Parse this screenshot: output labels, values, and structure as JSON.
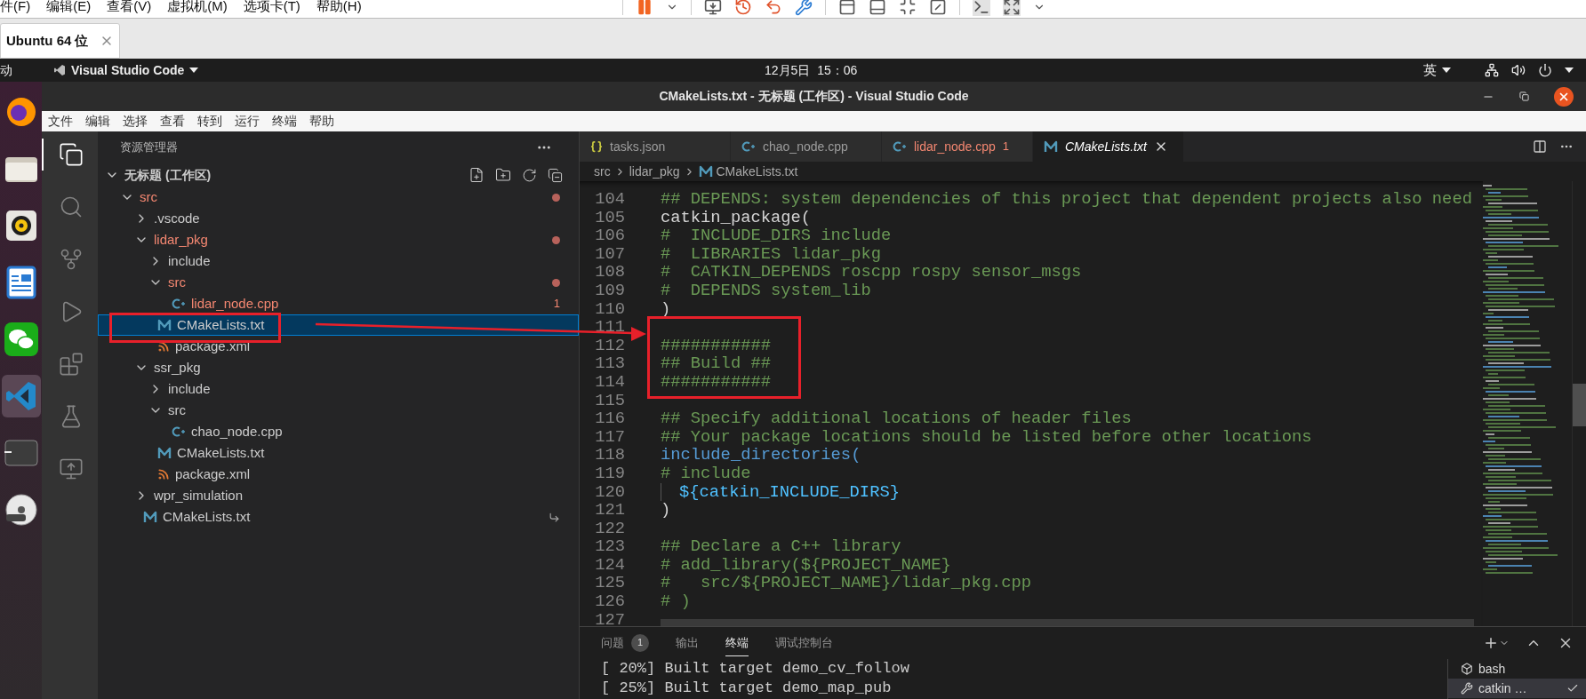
{
  "vm": {
    "menu": [
      "件(F)",
      "编辑(E)",
      "查看(V)",
      "虚拟机(M)",
      "选项卡(T)",
      "帮助(H)"
    ],
    "tabs": [
      {
        "label": "Ubuntu 64 位",
        "selected": true
      }
    ]
  },
  "ubuntu_bar": {
    "activities": "动",
    "app": "Visual Studio Code",
    "clock": "12月5日  15：06",
    "input_method": "英"
  },
  "dock": [
    {
      "kind": "firefox",
      "selected": false
    },
    {
      "kind": "files",
      "selected": false
    },
    {
      "kind": "speaker",
      "selected": false
    },
    {
      "kind": "writer",
      "selected": false
    },
    {
      "kind": "chat",
      "selected": false
    },
    {
      "kind": "vscode",
      "selected": true
    },
    {
      "kind": "terminal",
      "selected": false
    },
    {
      "kind": "disc",
      "selected": false
    }
  ],
  "window": {
    "title": "CMakeLists.txt - 无标题 (工作区) - Visual Studio Code"
  },
  "menu": [
    "文件",
    "编辑",
    "选择",
    "查看",
    "转到",
    "运行",
    "终端",
    "帮助"
  ],
  "activity_bar": [
    {
      "kind": "explorer",
      "selected": true
    },
    {
      "kind": "search",
      "selected": false
    },
    {
      "kind": "scm",
      "selected": false
    },
    {
      "kind": "debug",
      "selected": false
    },
    {
      "kind": "extensions",
      "selected": false
    },
    {
      "kind": "testing",
      "selected": false
    },
    {
      "kind": "remote",
      "selected": false
    }
  ],
  "sidebar": {
    "title": "资源管理器",
    "workspace": {
      "label": "无标题 (工作区)",
      "expanded": true,
      "children": [
        {
          "label": "src",
          "kind": "folder",
          "expanded": true,
          "error": true,
          "selected": false,
          "children": [
            {
              "label": ".vscode",
              "kind": "folder",
              "expanded": false,
              "error": false,
              "selected": false
            },
            {
              "label": "lidar_pkg",
              "kind": "folder",
              "expanded": true,
              "error": true,
              "selected": false,
              "children": [
                {
                  "label": "include",
                  "kind": "folder",
                  "expanded": false,
                  "error": false,
                  "selected": false
                },
                {
                  "label": "src",
                  "kind": "folder",
                  "expanded": true,
                  "error": true,
                  "selected": false,
                  "children": [
                    {
                      "label": "lidar_node.cpp",
                      "kind": "cpp",
                      "error": true,
                      "badge": "1",
                      "selected": false
                    }
                  ]
                },
                {
                  "label": "CMakeLists.txt",
                  "kind": "cmake",
                  "error": false,
                  "selected": true
                },
                {
                  "label": "package.xml",
                  "kind": "xml",
                  "error": false,
                  "selected": false
                }
              ]
            },
            {
              "label": "ssr_pkg",
              "kind": "folder",
              "expanded": true,
              "error": false,
              "selected": false,
              "children": [
                {
                  "label": "include",
                  "kind": "folder",
                  "expanded": false,
                  "error": false,
                  "selected": false
                },
                {
                  "label": "src",
                  "kind": "folder",
                  "expanded": true,
                  "error": false,
                  "selected": false,
                  "children": [
                    {
                      "label": "chao_node.cpp",
                      "kind": "cpp",
                      "error": false,
                      "selected": false
                    }
                  ]
                },
                {
                  "label": "CMakeLists.txt",
                  "kind": "cmake",
                  "error": false,
                  "selected": false
                },
                {
                  "label": "package.xml",
                  "kind": "xml",
                  "error": false,
                  "selected": false
                }
              ]
            },
            {
              "label": "wpr_simulation",
              "kind": "folder",
              "expanded": false,
              "error": false,
              "selected": false
            },
            {
              "label": "CMakeLists.txt",
              "kind": "cmake",
              "error": false,
              "selected": false,
              "link": true
            }
          ]
        }
      ]
    }
  },
  "editor_tabs": [
    {
      "label": "tasks.json",
      "kind": "json",
      "selected": false,
      "error": false
    },
    {
      "label": "chao_node.cpp",
      "kind": "cpp",
      "selected": false,
      "error": false
    },
    {
      "label": "lidar_node.cpp",
      "kind": "cpp",
      "selected": false,
      "error": true,
      "badge": "1"
    },
    {
      "label": "CMakeLists.txt",
      "kind": "cmake",
      "selected": true,
      "error": false
    }
  ],
  "breadcrumb": [
    "src",
    "lidar_pkg",
    "CMakeLists.txt"
  ],
  "code": [
    {
      "n": "104",
      "text": "## DEPENDS: system dependencies of this project that dependent projects also need",
      "kind": "comment",
      "indented": false
    },
    {
      "n": "105",
      "text": "catkin_package(",
      "kind": "plain",
      "indented": false
    },
    {
      "n": "106",
      "text": "#  INCLUDE_DIRS include",
      "kind": "comment",
      "indented": false
    },
    {
      "n": "107",
      "text": "#  LIBRARIES lidar_pkg",
      "kind": "comment",
      "indented": false
    },
    {
      "n": "108",
      "text": "#  CATKIN_DEPENDS roscpp rospy sensor_msgs",
      "kind": "comment",
      "indented": false
    },
    {
      "n": "109",
      "text": "#  DEPENDS system_lib",
      "kind": "comment",
      "indented": false
    },
    {
      "n": "110",
      "text": ")",
      "kind": "plain",
      "indented": false
    },
    {
      "n": "111"
    },
    {
      "n": "112",
      "text": "###########",
      "kind": "comment",
      "indented": false
    },
    {
      "n": "113",
      "text": "## Build ##",
      "kind": "comment",
      "indented": false
    },
    {
      "n": "114",
      "text": "###########",
      "kind": "comment",
      "indented": false
    },
    {
      "n": "115"
    },
    {
      "n": "116",
      "text": "## Specify additional locations of header files",
      "kind": "comment",
      "indented": false
    },
    {
      "n": "117",
      "text": "## Your package locations should be listed before other locations",
      "kind": "comment",
      "indented": false
    },
    {
      "n": "118",
      "text": "include_directories(",
      "kind": "keyword",
      "indented": false
    },
    {
      "n": "119",
      "text": "# include",
      "kind": "comment",
      "indented": false
    },
    {
      "n": "120",
      "text": "${catkin_INCLUDE_DIRS}",
      "kind": "variable",
      "indented": true
    },
    {
      "n": "121",
      "text": ")",
      "kind": "plain",
      "indented": false
    },
    {
      "n": "122"
    },
    {
      "n": "123",
      "text": "## Declare a C++ library",
      "kind": "comment",
      "indented": false
    },
    {
      "n": "124",
      "text": "# add_library(${PROJECT_NAME}",
      "kind": "comment",
      "indented": false
    },
    {
      "n": "125",
      "text": "#   src/${PROJECT_NAME}/lidar_pkg.cpp",
      "kind": "comment",
      "indented": false
    },
    {
      "n": "126",
      "text": "# )",
      "kind": "comment",
      "indented": false
    },
    {
      "n": "127"
    }
  ],
  "panel": {
    "tabs": [
      {
        "label": "问题",
        "badge": "1",
        "selected": false
      },
      {
        "label": "输出",
        "selected": false
      },
      {
        "label": "终端",
        "selected": true
      },
      {
        "label": "调试控制台",
        "selected": false
      }
    ],
    "terminal_lines": [
      "[ 20%] Built target demo_cv_follow",
      "[ 25%] Built target demo_map_pub"
    ],
    "terminals": [
      {
        "label": "bash",
        "kind": "shell",
        "selected": false
      },
      {
        "label": "catkin …",
        "kind": "task",
        "selected": true
      }
    ]
  }
}
